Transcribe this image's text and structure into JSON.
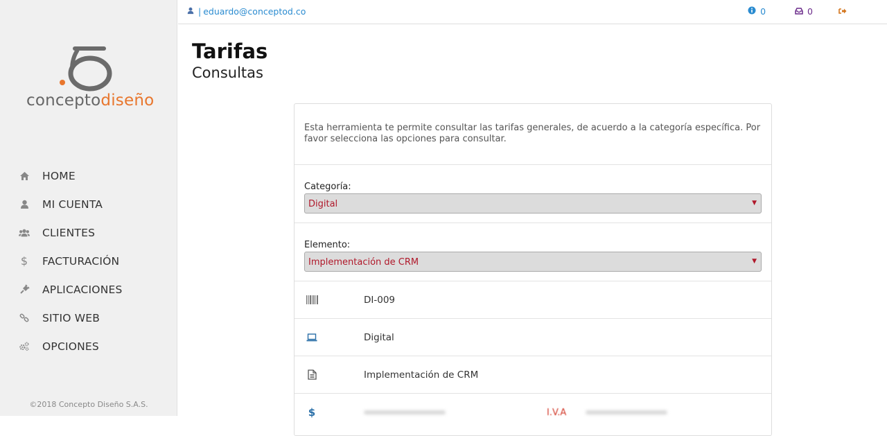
{
  "logo": {
    "text_a": "concepto",
    "text_b": "diseño"
  },
  "sidebar": {
    "items": [
      {
        "label": "HOME",
        "icon": "home-icon"
      },
      {
        "label": "MI CUENTA",
        "icon": "user-icon"
      },
      {
        "label": "CLIENTES",
        "icon": "users-icon"
      },
      {
        "label": "FACTURACIÓN",
        "icon": "dollar-icon"
      },
      {
        "label": "APLICACIONES",
        "icon": "plug-icon"
      },
      {
        "label": "SITIO WEB",
        "icon": "link-icon"
      },
      {
        "label": "OPCIONES",
        "icon": "gears-icon"
      }
    ],
    "footer": "©2018 Concepto Diseño S.A.S."
  },
  "topbar": {
    "separator": "|",
    "user_email": "eduardo@conceptod.co",
    "info_count": "0",
    "inbox_count": "0"
  },
  "page": {
    "title": "Tarifas",
    "subtitle": "Consultas"
  },
  "form": {
    "intro": "Esta herramienta te permite consultar las tarifas generales, de acuerdo a la categoría específica. Por favor selecciona las opciones para consultar.",
    "categoria_label": "Categoría:",
    "categoria_value": "Digital",
    "elemento_label": "Elemento:",
    "elemento_value": "Implementación de CRM"
  },
  "details": {
    "code": "DI-009",
    "category": "Digital",
    "element": "Implementación de CRM",
    "iva_label": "I.V.A"
  },
  "colors": {
    "accent": "#2a8bd0",
    "brand": "#e8762d",
    "select_text": "#b0182a",
    "inbox": "#6a2a8a"
  }
}
